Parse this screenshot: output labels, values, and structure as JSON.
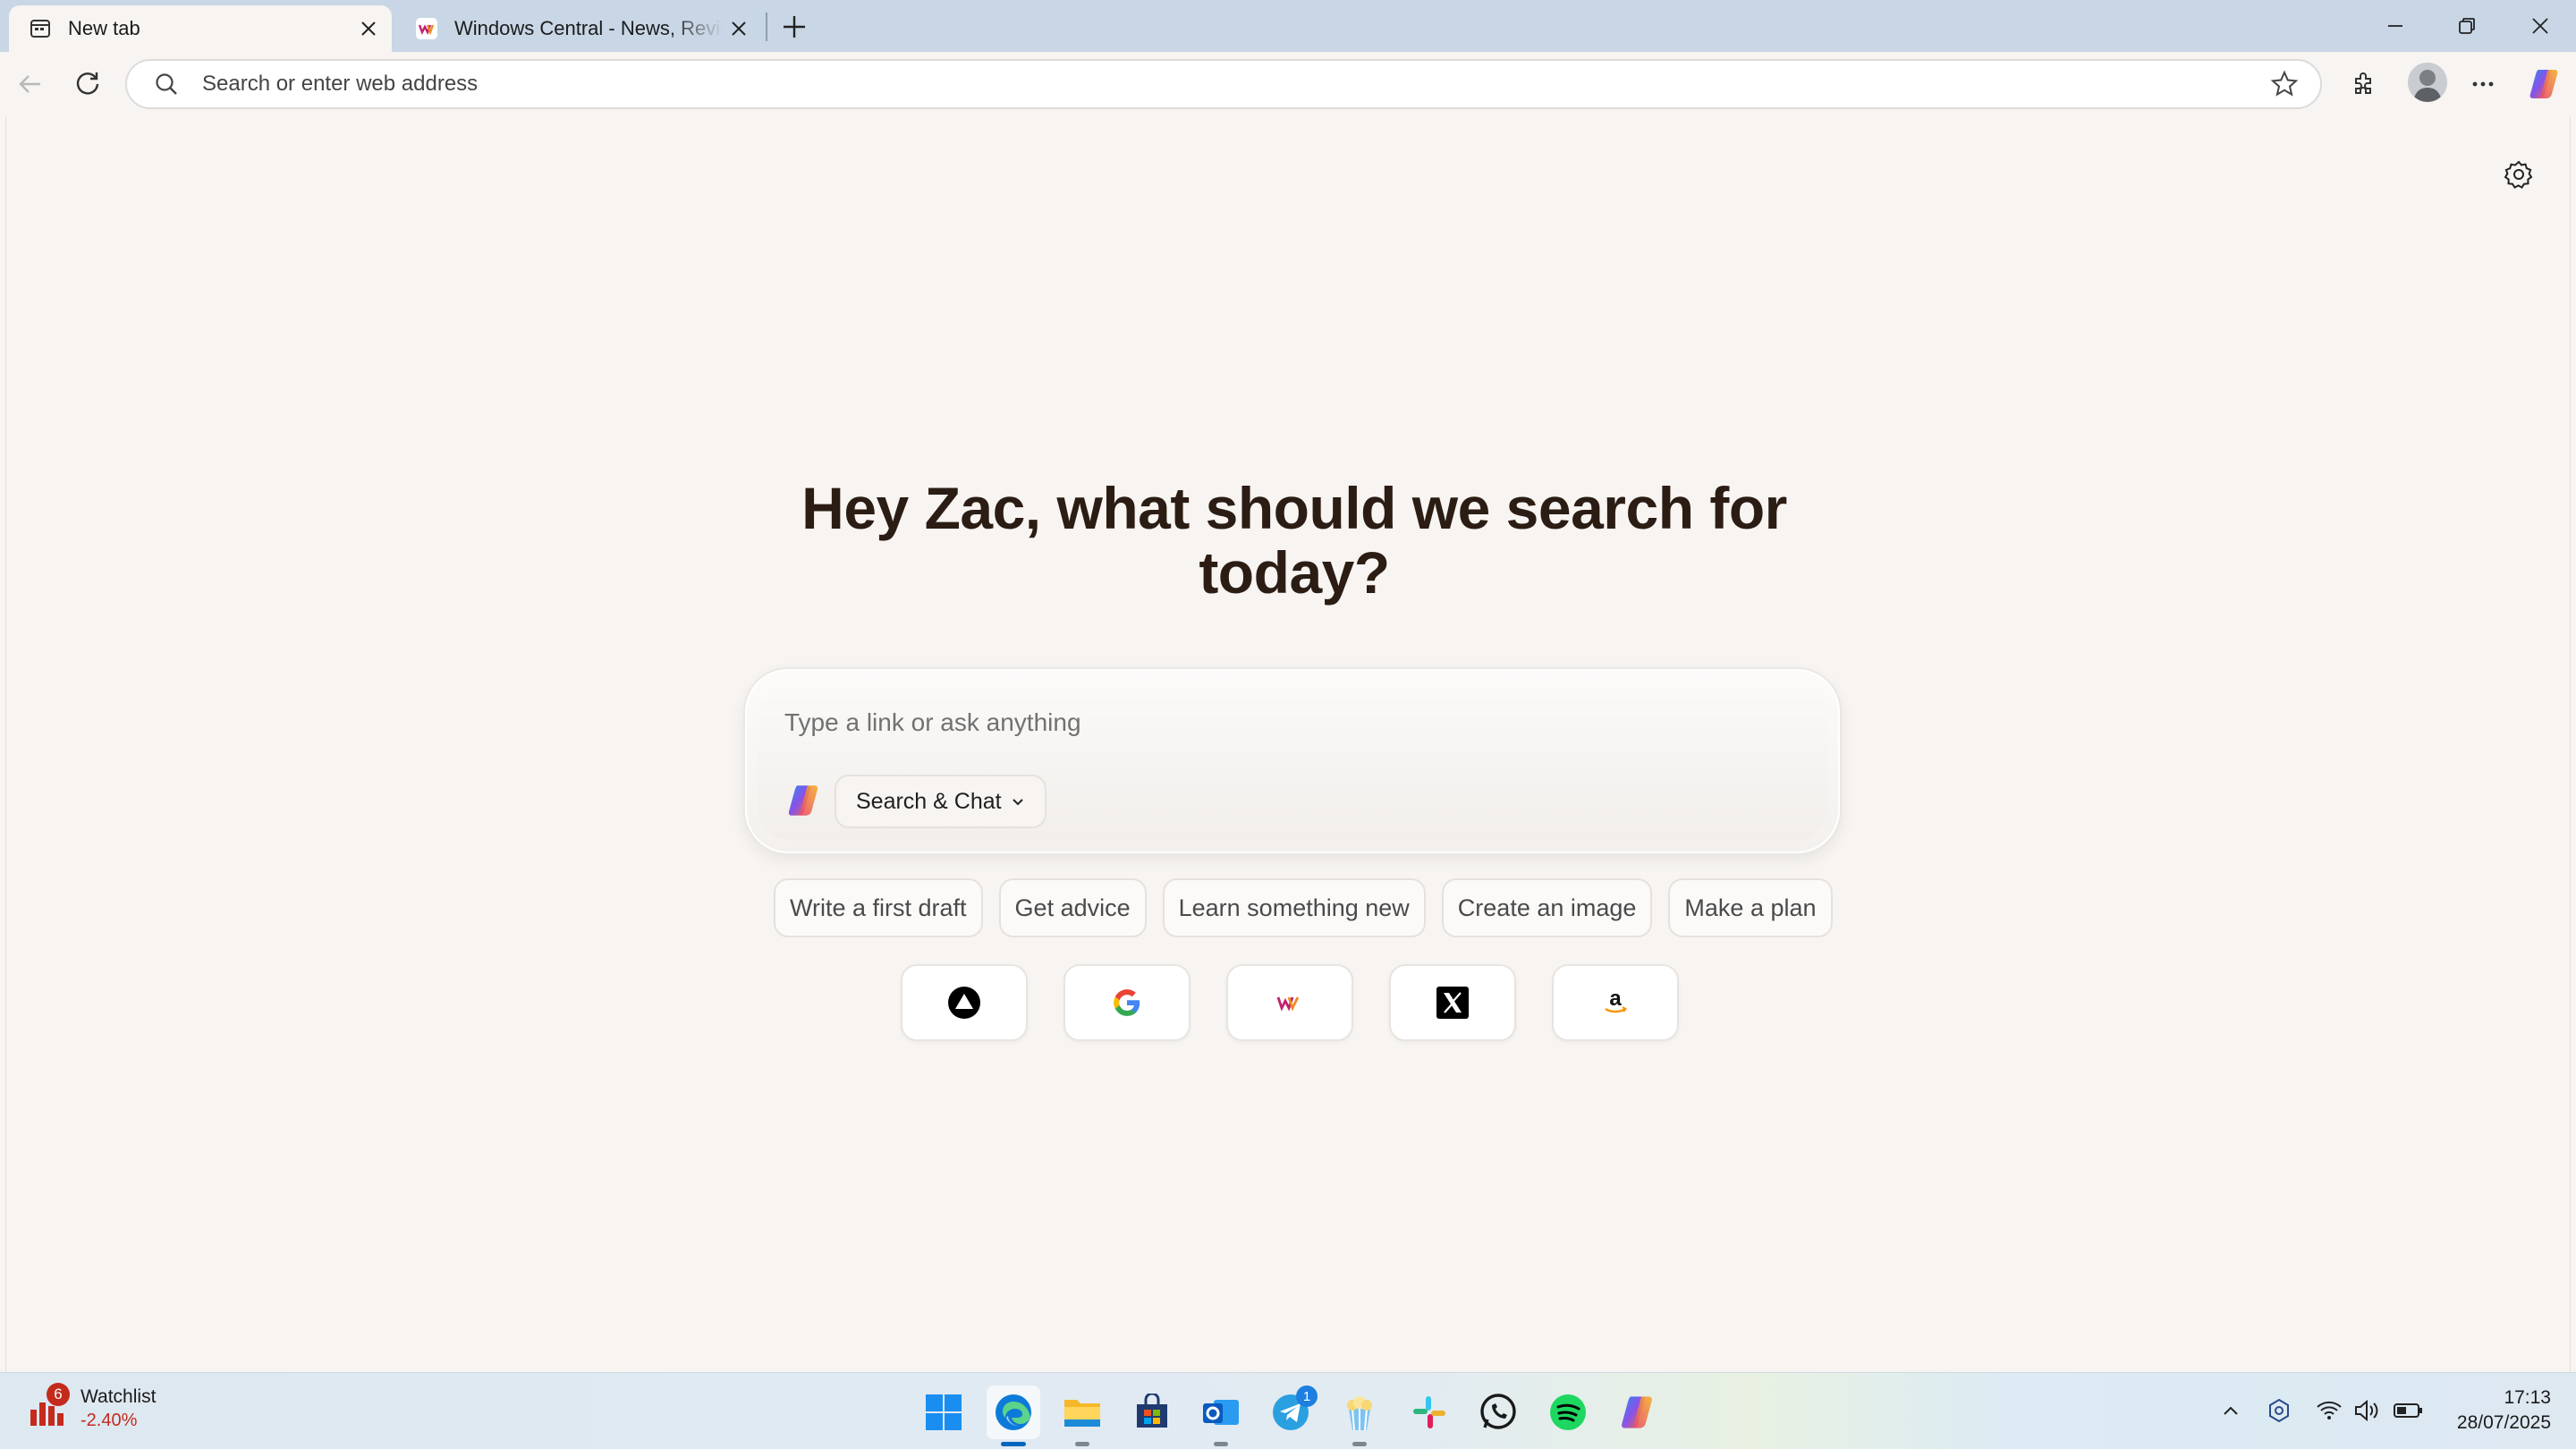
{
  "browser": {
    "tabs": [
      {
        "title": "New tab",
        "active": true
      },
      {
        "title": "Windows Central - News, Reviews",
        "active": false
      }
    ],
    "address_bar": {
      "placeholder": "Search or enter web address",
      "value": ""
    }
  },
  "newtab": {
    "greeting": "Hey Zac, what should we search for today?",
    "prompt_placeholder": "Type a link or ask anything",
    "mode_label": "Search & Chat",
    "suggestions": [
      "Write a first draft",
      "Get advice",
      "Learn something new",
      "Create an image",
      "Make a plan"
    ],
    "shortcuts": [
      "Vercel",
      "Google",
      "Windows Central",
      "X",
      "Amazon"
    ]
  },
  "taskbar": {
    "widget": {
      "title": "Watchlist",
      "change": "-2.40%",
      "badge": "6"
    },
    "apps": [
      "start",
      "edge",
      "file-explorer",
      "microsoft-store",
      "outlook",
      "telegram",
      "zoo-app",
      "slack",
      "whatsapp",
      "spotify",
      "copilot"
    ],
    "telegram_badge": "1",
    "clock": {
      "time": "17:13",
      "date": "28/07/2025"
    }
  }
}
